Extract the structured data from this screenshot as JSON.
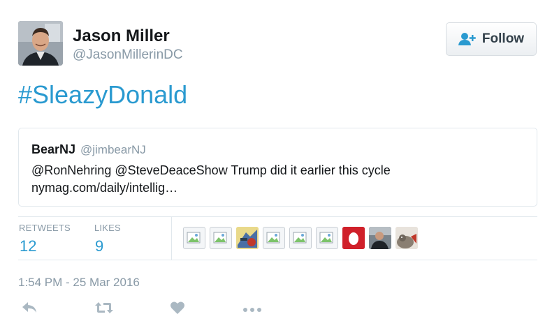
{
  "author": {
    "name": "Jason Miller",
    "handle": "@JasonMillerinDC"
  },
  "follow_button": {
    "label": "Follow",
    "icon": "add-user-icon"
  },
  "tweet_text": "#SleazyDonald",
  "quoted_tweet": {
    "name": "BearNJ",
    "handle": "@jimbearNJ",
    "text_line1": "@RonNehring @SteveDeaceShow Trump did it earlier this cycle",
    "text_line2": "nymag.com/daily/intellig…"
  },
  "stats": {
    "retweets_label": "RETWEETS",
    "retweets_value": "12",
    "likes_label": "LIKES",
    "likes_value": "9"
  },
  "liker_avatars": [
    "broken-image-icon",
    "broken-image-icon",
    "illustrated-avatar",
    "broken-image-icon",
    "broken-image-icon",
    "broken-image-icon",
    "red-egg-avatar",
    "photo-avatar",
    "photo-avatar"
  ],
  "timestamp": "1:54 PM - 25 Mar 2016",
  "actions": [
    "reply-icon",
    "retweet-icon",
    "like-icon",
    "more-icon"
  ],
  "colors": {
    "link": "#2a9ad0",
    "muted": "#8899a6",
    "follow_icon": "#2a9ad0"
  }
}
